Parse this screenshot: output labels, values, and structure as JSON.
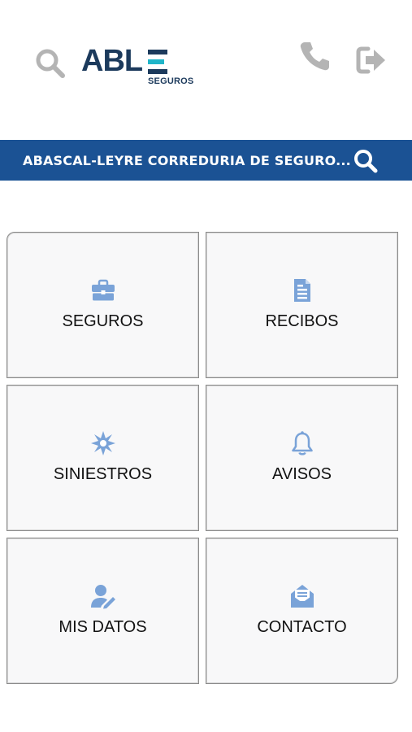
{
  "colors": {
    "brand_dark": "#1c3a5c",
    "brand_accent": "#20b5c9",
    "bar_blue": "#1b5294",
    "icon_blue": "#7aa3d8",
    "header_icon_gray": "#b4b4b4"
  },
  "header": {
    "logo": {
      "word": "ABL",
      "subtitle": "SEGUROS"
    },
    "icons": {
      "search": "search-icon",
      "phone": "phone-icon",
      "logout": "logout-icon"
    }
  },
  "company_bar": {
    "name": "ABASCAL-LEYRE CORREDURIA DE SEGURO...",
    "icon": "search-icon"
  },
  "menu": [
    {
      "label": "SEGUROS",
      "icon": "briefcase-icon"
    },
    {
      "label": "RECIBOS",
      "icon": "document-icon"
    },
    {
      "label": "SINIESTROS",
      "icon": "burst-icon"
    },
    {
      "label": "AVISOS",
      "icon": "bell-icon"
    },
    {
      "label": "MIS DATOS",
      "icon": "user-edit-icon"
    },
    {
      "label": "CONTACTO",
      "icon": "envelope-open-icon"
    }
  ]
}
